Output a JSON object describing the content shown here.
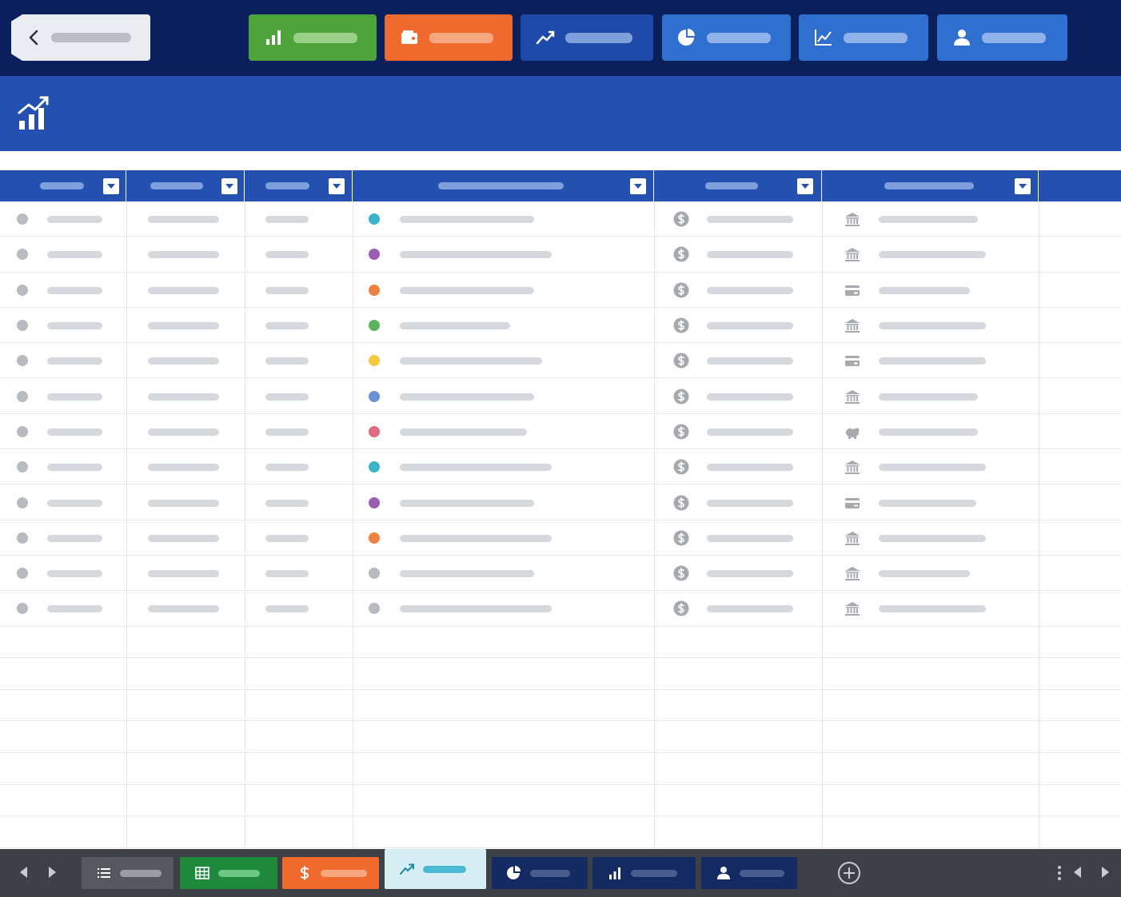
{
  "top_nav": {
    "back": {
      "icon": "chevron-left-icon"
    },
    "buttons": [
      {
        "id": "charts",
        "icon": "bar-chart-icon",
        "color": "#4ea33a"
      },
      {
        "id": "wallet",
        "icon": "wallet-icon",
        "color": "#ef6a2c"
      },
      {
        "id": "trend",
        "icon": "trend-up-icon",
        "color": "#1f49a8"
      },
      {
        "id": "pie",
        "icon": "pie-chart-icon",
        "color": "#2f6fd0"
      },
      {
        "id": "line",
        "icon": "line-chart-icon",
        "color": "#2f6fd0"
      },
      {
        "id": "user",
        "icon": "user-icon",
        "color": "#2f6fd0"
      }
    ]
  },
  "header": {
    "icon": "growth-chart-icon"
  },
  "table": {
    "columns": [
      {
        "id": "col-1"
      },
      {
        "id": "col-2"
      },
      {
        "id": "col-3"
      },
      {
        "id": "col-4"
      },
      {
        "id": "col-5"
      },
      {
        "id": "col-6"
      }
    ],
    "rows": [
      {
        "category_color": "#3bb4c9",
        "account_icon": "bank-icon"
      },
      {
        "category_color": "#9a5fb5",
        "account_icon": "bank-icon"
      },
      {
        "category_color": "#f08040",
        "account_icon": "card-icon"
      },
      {
        "category_color": "#5ab55a",
        "account_icon": "bank-icon"
      },
      {
        "category_color": "#f5c842",
        "account_icon": "card-icon"
      },
      {
        "category_color": "#6f8fd6",
        "account_icon": "bank-icon"
      },
      {
        "category_color": "#e06a82",
        "account_icon": "piggy-bank-icon"
      },
      {
        "category_color": "#3bb4c9",
        "account_icon": "bank-icon"
      },
      {
        "category_color": "#9a5fb5",
        "account_icon": "card-icon"
      },
      {
        "category_color": "#f08040",
        "account_icon": "bank-icon"
      },
      {
        "category_color": "#b8bbc0",
        "account_icon": "bank-icon"
      },
      {
        "category_color": "#b8bbc0",
        "account_icon": "bank-icon"
      }
    ]
  },
  "bottom_tabs": [
    {
      "id": "list",
      "icon": "list-icon",
      "color": "#55585e"
    },
    {
      "id": "sheet",
      "icon": "table-icon",
      "color": "#1f8a3c"
    },
    {
      "id": "money",
      "icon": "dollar-icon",
      "color": "#ef6a2c"
    },
    {
      "id": "trend",
      "icon": "trend-up-icon",
      "color": "#d7eef5",
      "active": true
    },
    {
      "id": "pie",
      "icon": "pie-chart-icon",
      "color": "#132a63"
    },
    {
      "id": "bars",
      "icon": "bar-chart-icon",
      "color": "#132a63"
    },
    {
      "id": "user",
      "icon": "user-icon",
      "color": "#132a63"
    }
  ]
}
